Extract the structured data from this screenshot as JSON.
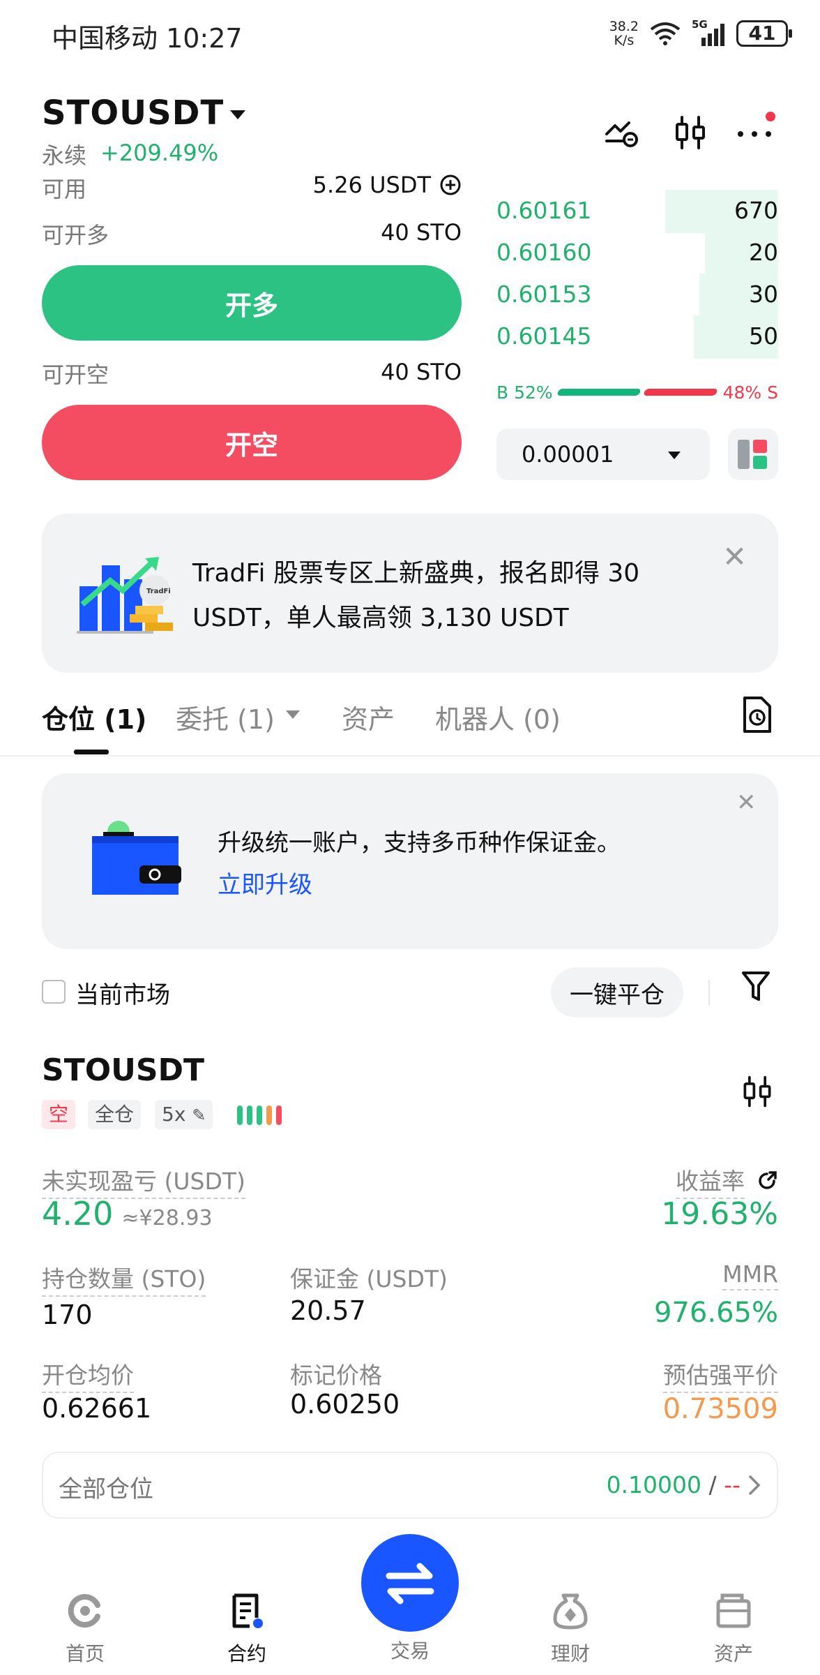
{
  "status_bar": {
    "carrier_time": "中国移动 10:27",
    "net_speed": "38.2",
    "net_unit": "K/s",
    "network": "5G",
    "battery": "41"
  },
  "header": {
    "pair": "STOUSDT",
    "contract_type": "永续",
    "change": "+209.49%"
  },
  "trade": {
    "available_label": "可用",
    "available_value": "5.26 USDT",
    "can_long_label": "可开多",
    "can_long_value": "40 STO",
    "long_button": "开多",
    "can_short_label": "可开空",
    "can_short_value": "40 STO",
    "short_button": "开空"
  },
  "order_book": {
    "rows": [
      {
        "price": "0.60161",
        "qty": "670",
        "depth": 0.4
      },
      {
        "price": "0.60160",
        "qty": "20",
        "depth": 0.26
      },
      {
        "price": "0.60153",
        "qty": "30",
        "depth": 0.28
      },
      {
        "price": "0.60145",
        "qty": "50",
        "depth": 0.3
      }
    ],
    "buy_ratio": "B 52%",
    "sell_ratio": "48% S",
    "precision": "0.00001"
  },
  "banner": {
    "text": "TradFi 股票专区上新盛典，报名即得 30 USDT，单人最高领 3,130 USDT",
    "badge": "TradFi",
    "close": "✕"
  },
  "tabs": [
    {
      "label": "仓位 (1)"
    },
    {
      "label": "委托 (1)"
    },
    {
      "label": "资产"
    },
    {
      "label": "机器人 (0)"
    }
  ],
  "upgrade": {
    "text": "升级统一账户，支持多币种作保证金。",
    "link": "立即升级",
    "close": "✕"
  },
  "filter": {
    "current_market": "当前市场",
    "close_all": "一键平仓"
  },
  "position": {
    "symbol": "STOUSDT",
    "tag_side": "空",
    "tag_margin": "全仓",
    "tag_leverage": "5x",
    "unrealized_label": "未实现盈亏 (USDT)",
    "unrealized_value": "4.20",
    "unrealized_cny": "≈¥28.93",
    "roe_label": "收益率",
    "roe_value": "19.63%",
    "qty_label": "持仓数量 (STO)",
    "qty_value": "170",
    "margin_label": "保证金 (USDT)",
    "margin_value": "20.57",
    "mmr_label": "MMR",
    "mmr_value": "976.65%",
    "entry_label": "开仓均价",
    "entry_value": "0.62661",
    "mark_label": "标记价格",
    "mark_value": "0.60250",
    "liq_label": "预估强平价",
    "liq_value": "0.73509"
  },
  "all_positions": {
    "label": "全部仓位",
    "value": "0.10000",
    "sep": "/",
    "value2": "--"
  },
  "nav": [
    {
      "label": "首页",
      "icon": "home-icon"
    },
    {
      "label": "合约",
      "icon": "contract-icon"
    },
    {
      "label": "交易",
      "icon": "swap-icon"
    },
    {
      "label": "理财",
      "icon": "earn-icon"
    },
    {
      "label": "资产",
      "icon": "wallet-icon"
    }
  ],
  "colors": {
    "green": "#2bc283",
    "red": "#f44c60",
    "blue": "#1a56ff",
    "orange": "#f39a4e"
  }
}
